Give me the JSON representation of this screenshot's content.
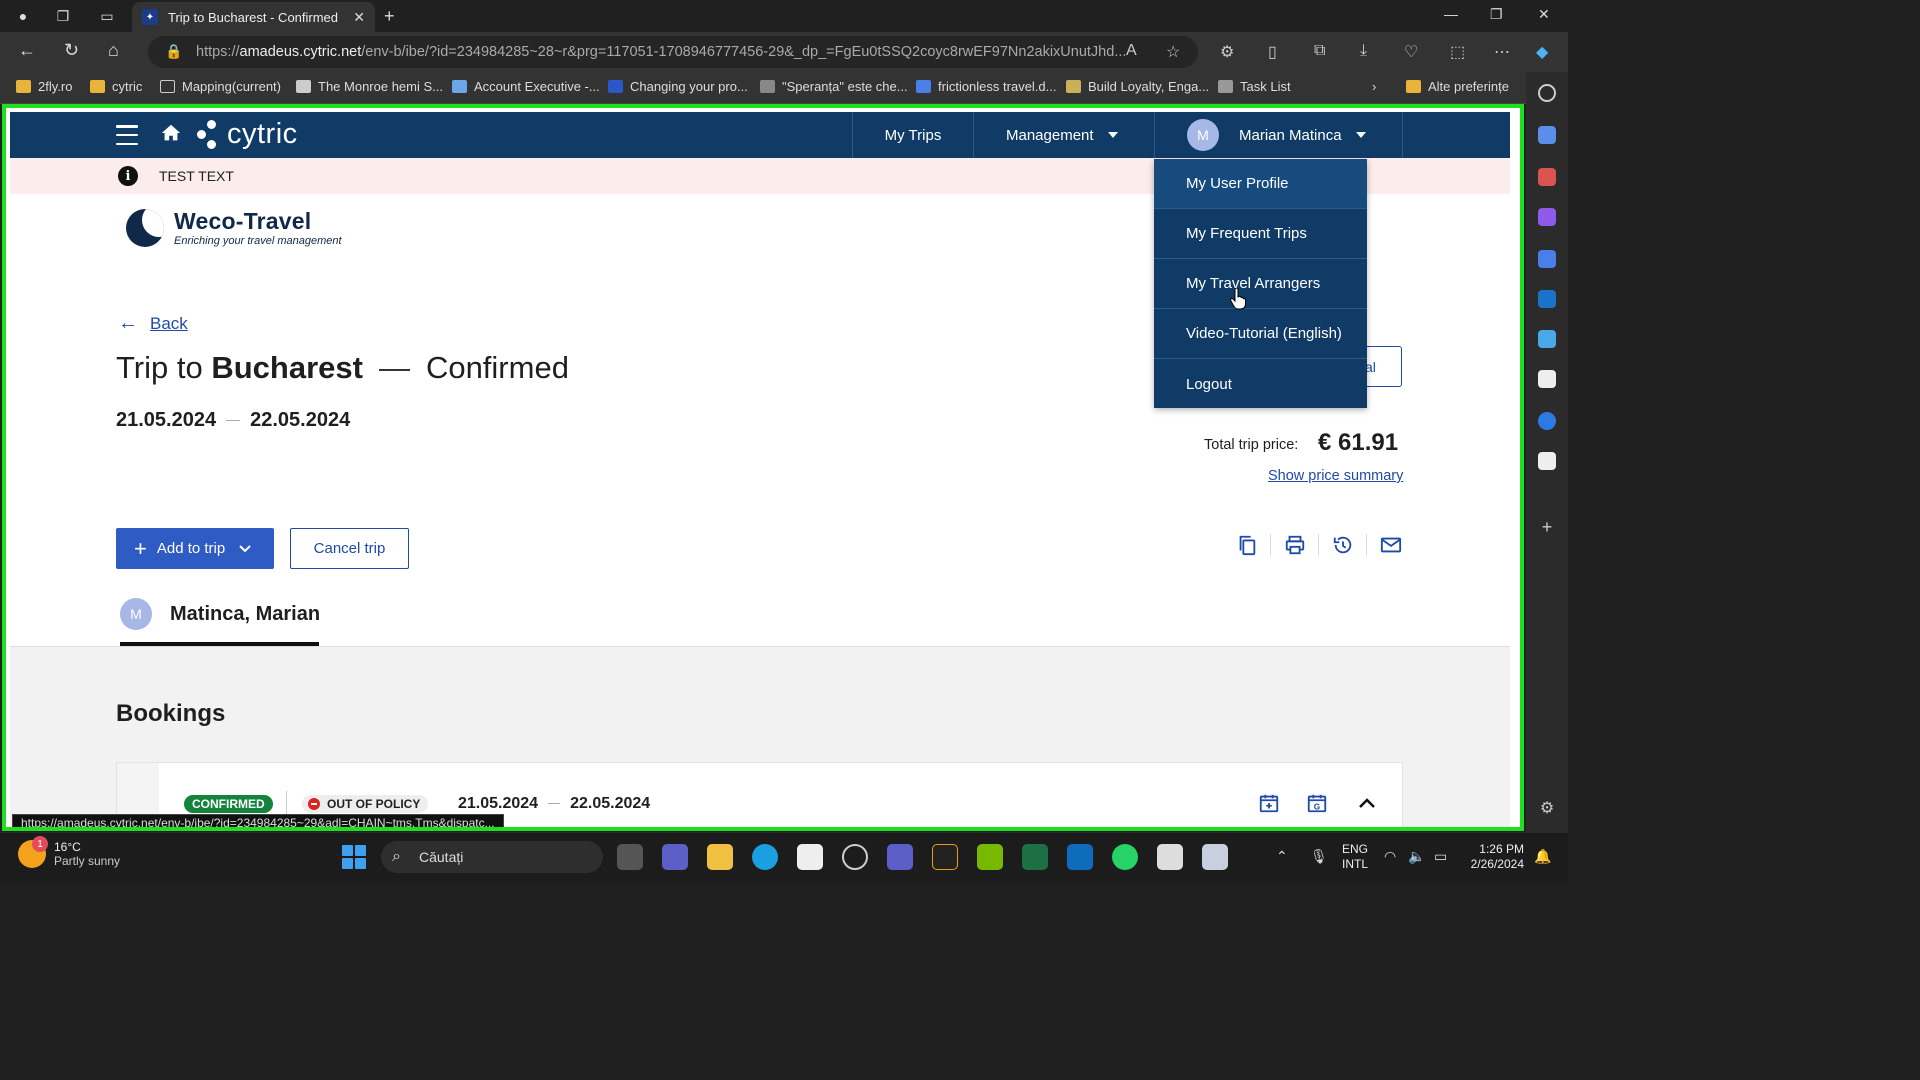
{
  "browser": {
    "tab_title": "Trip to Bucharest - Confirmed",
    "url_prefix": "https://",
    "url_host": "amadeus.cytric.net",
    "url_rest": "/env-b/ibe/?id=234984285~28~r&prg=117051-1708946777456-29&_dp_=FgEu0tSSQ2coyc8rwEF97Nn2akixUnutJhd...",
    "bookmarks": [
      "2fly.ro",
      "cytric",
      "Mapping(current)",
      "The Monroe hemi S...",
      "Account Executive -...",
      "Changing your pro...",
      "\"Speranța\" este che...",
      "frictionless travel.d...",
      "Build Loyalty, Enga...",
      "Task List"
    ],
    "bookmarks_other": "Alte preferințe",
    "status_url": "https://amadeus.cytric.net/env-b/ibe/?id=234984285~29&adl=CHAIN~tms.Tms&dispatc..."
  },
  "app": {
    "logo_text": "cytric",
    "nav": {
      "my_trips": "My Trips",
      "management": "Management",
      "user_initial": "M",
      "user_name": "Marian Matinca"
    },
    "notice": {
      "icon": "info-icon",
      "text": "TEST TEXT"
    },
    "brand": {
      "name": "Weco-Travel",
      "tagline": "Enriching your travel management"
    },
    "back_label": "Back",
    "trip": {
      "title_prefix": "Trip to",
      "city": "Bucharest",
      "dash": "—",
      "status": "Confirmed",
      "date_from": "21.05.2024",
      "date_to": "22.05.2024"
    },
    "price": {
      "label": "Total trip price:",
      "value": "€ 61.91",
      "summary_link": "Show price summary"
    },
    "partial_button_text": "val",
    "buttons": {
      "add_to_trip": "Add to trip",
      "cancel_trip": "Cancel trip"
    },
    "traveler": {
      "initial": "M",
      "name": "Matinca, Marian"
    },
    "bookings_heading": "Bookings",
    "booking": {
      "status": "CONFIRMED",
      "policy": "OUT OF POLICY",
      "date_from": "21.05.2024",
      "date_to": "22.05.2024"
    },
    "user_menu": [
      "My User Profile",
      "My Frequent Trips",
      "My Travel Arrangers",
      "Video-Tutorial (English)",
      "Logout"
    ]
  },
  "taskbar": {
    "weather_temp": "16°C",
    "weather_desc": "Partly sunny",
    "weather_badge": "1",
    "search_placeholder": "Căutați",
    "lang1": "ENG",
    "lang2": "INTL",
    "time": "1:26 PM",
    "date": "2/26/2024"
  },
  "colors": {
    "nav_bg": "#0f3b66",
    "accent": "#2f5bc4",
    "confirmed": "#14833b",
    "highlight_border": "#1ee01e"
  }
}
